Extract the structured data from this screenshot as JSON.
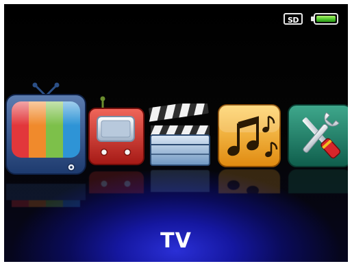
{
  "status_bar": {
    "storage_label": "SD",
    "battery_level": 1.0,
    "battery_color": "#49c22a"
  },
  "menu": {
    "selected_index": 0,
    "items": [
      {
        "icon": "tv-icon",
        "selected": true
      },
      {
        "icon": "radio-icon",
        "selected": false
      },
      {
        "icon": "video-clapperboard-icon",
        "selected": false
      },
      {
        "icon": "music-notes-icon",
        "selected": false
      },
      {
        "icon": "settings-tools-icon",
        "selected": false
      }
    ]
  },
  "selected_title": "TV"
}
